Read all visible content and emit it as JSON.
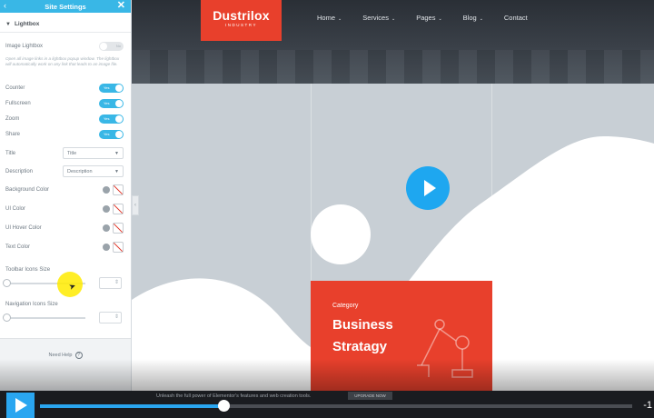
{
  "panel": {
    "title": "Site Settings",
    "section_title": "Lightbox",
    "image_lightbox": {
      "label": "Image Lightbox",
      "toggle_text": "No",
      "description": "Open all image links in a lightbox popup window. The lightbox will automatically work on any link that leads to an image file."
    },
    "toggles": [
      {
        "label": "Counter",
        "value": "Yes"
      },
      {
        "label": "Fullscreen",
        "value": "Yes"
      },
      {
        "label": "Zoom",
        "value": "Yes"
      },
      {
        "label": "Share",
        "value": "Yes"
      }
    ],
    "title_field": {
      "label": "Title",
      "value": "Title"
    },
    "description_field": {
      "label": "Description",
      "value": "Description"
    },
    "colors": [
      {
        "label": "Background Color"
      },
      {
        "label": "UI Color"
      },
      {
        "label": "UI Hover Color"
      },
      {
        "label": "Text Color"
      }
    ],
    "toolbar_icons_size": {
      "label": "Toolbar Icons Size"
    },
    "navigation_icons_size": {
      "label": "Navigation Icons Size"
    },
    "need_help": "Need Help",
    "help_icon": "?"
  },
  "site": {
    "logo": {
      "brand": "Dustrilox",
      "tagline": "INDUSTRY"
    },
    "nav": [
      {
        "label": "Home",
        "has_dropdown": true
      },
      {
        "label": "Services",
        "has_dropdown": true
      },
      {
        "label": "Pages",
        "has_dropdown": true
      },
      {
        "label": "Blog",
        "has_dropdown": true
      },
      {
        "label": "Contact",
        "has_dropdown": false
      }
    ],
    "card": {
      "category": "Category",
      "heading_line1": "Business",
      "heading_line2": "Stratagy"
    },
    "accent_color": "#e8402c"
  },
  "video": {
    "promo_text": "Unleash the full power of Elementor's features and web creation tools.",
    "promo_button": "UPGRADE NOW",
    "time_remaining": "-1",
    "progress_fraction": 0.31,
    "accent_color": "#2aa6f0"
  }
}
